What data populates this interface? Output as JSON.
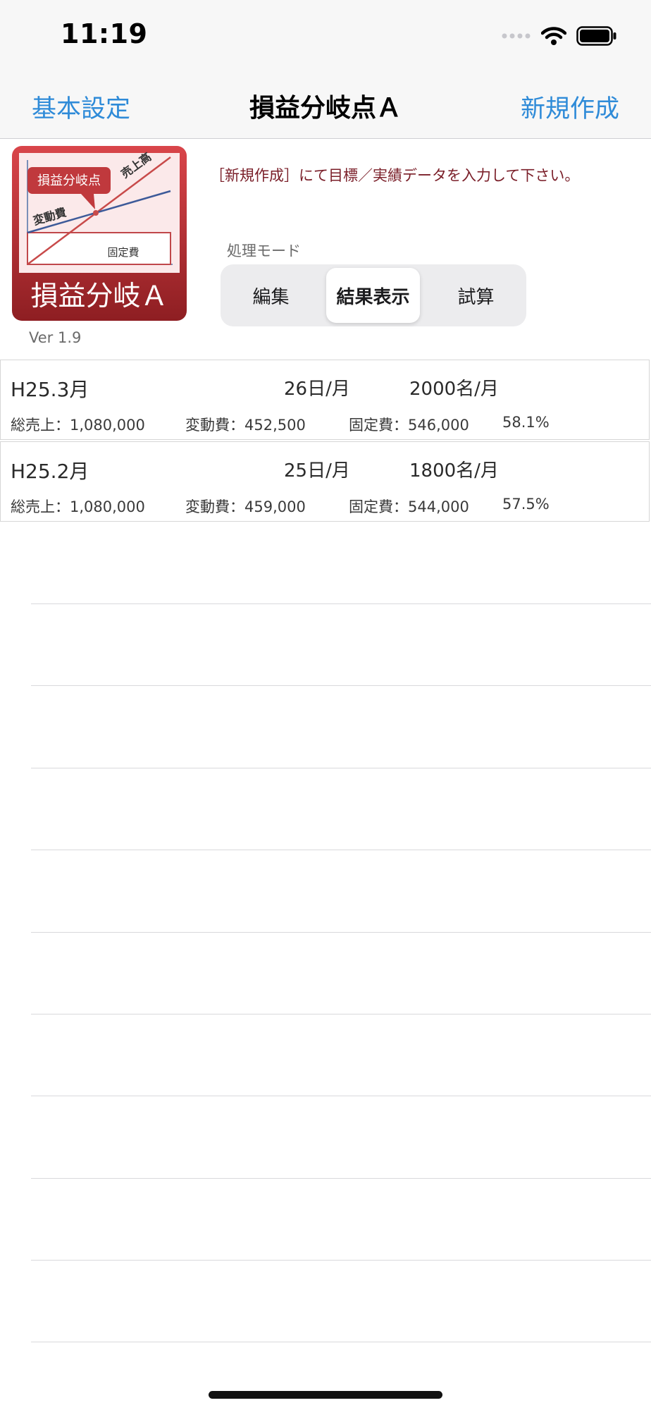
{
  "status": {
    "time": "11:19"
  },
  "nav": {
    "left": "基本設定",
    "title": "損益分岐点Ａ",
    "right": "新規作成"
  },
  "header": {
    "instruction": "［新規作成］にて目標／実績データを入力して下さい。",
    "mode_label": "処理モード",
    "version": "Ver 1.9"
  },
  "modes": [
    {
      "label": "編集",
      "selected": false
    },
    {
      "label": "結果表示",
      "selected": true
    },
    {
      "label": "試算",
      "selected": false
    }
  ],
  "icon": {
    "bubble": "損益分岐点",
    "sales_label": "売上高",
    "variable_label": "変動費",
    "fixed_label": "固定費",
    "banner": "損益分岐Ａ",
    "colors": {
      "frame": "#b73034",
      "panel": "#f9e6e8",
      "line_sales": "#c84a4a",
      "line_var": "#3d5a99"
    }
  },
  "records": [
    {
      "month": "H25.3月",
      "days": "26日/月",
      "people": "2000名/月",
      "sales": "総売上：1,080,000",
      "variable": "変動費：452,500",
      "fixed": "固定費：546,000",
      "rate": "58.1%"
    },
    {
      "month": "H25.2月",
      "days": "25日/月",
      "people": "1800名/月",
      "sales": "総売上：1,080,000",
      "variable": "変動費：459,000",
      "fixed": "固定費：544,000",
      "rate": "57.5%"
    }
  ],
  "colors": {
    "accent": "#2f8bd8",
    "instruction": "#7a1e28"
  }
}
